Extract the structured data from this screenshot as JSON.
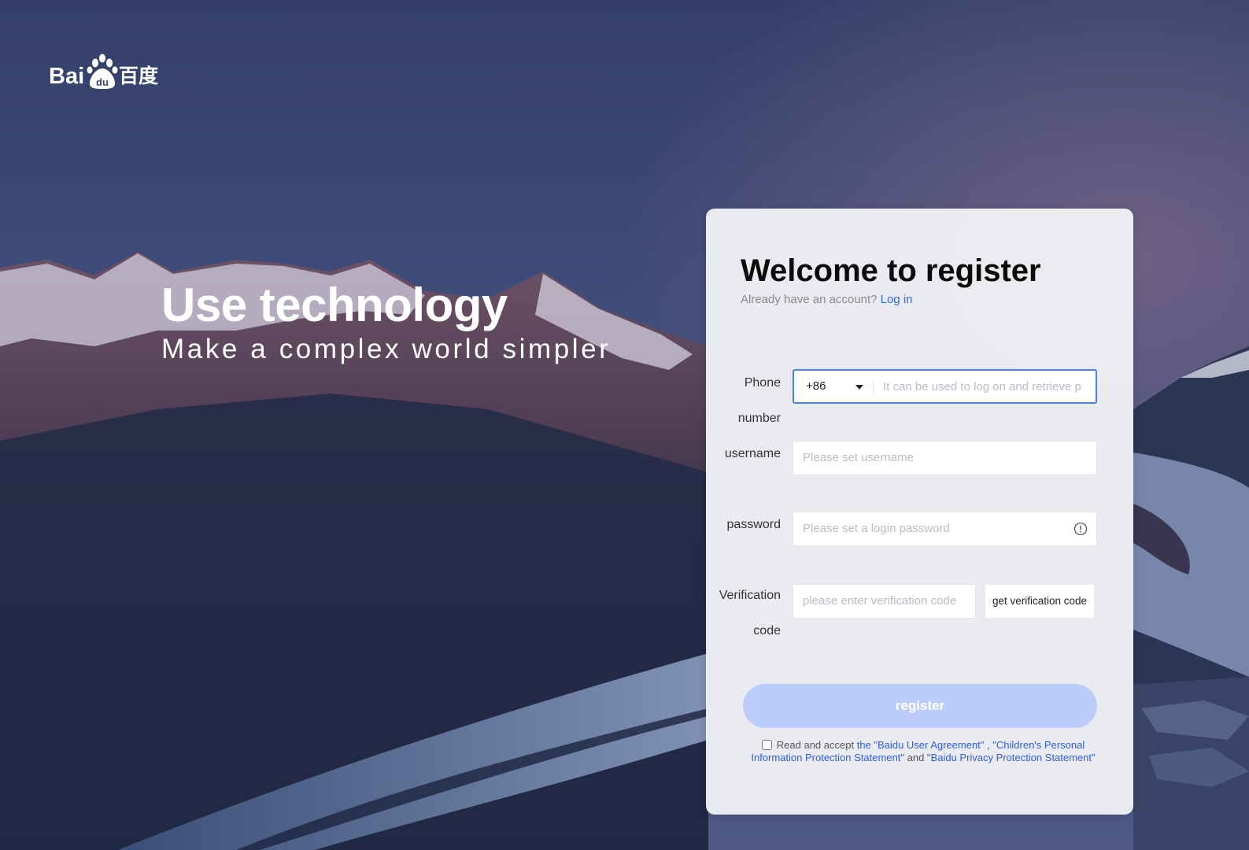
{
  "brand": {
    "logo_latin": "Bai",
    "logo_paw_text": "du",
    "logo_chinese": "百度",
    "accent_color": "#2f68f0"
  },
  "hero": {
    "title": "Use technology",
    "subtitle": "Make a complex world simpler"
  },
  "form": {
    "title": "Welcome to register",
    "already_text": "Already have an account?",
    "login_link": "Log in",
    "phone": {
      "label_line1": "Phone",
      "label_line2": "number",
      "country_code": "+86",
      "placeholder": "It can be used to log on and retrieve p"
    },
    "username": {
      "label": "username",
      "placeholder": "Please set username"
    },
    "password": {
      "label": "password",
      "placeholder": "Please set a login password",
      "icon": "info-circle-icon"
    },
    "verification": {
      "label_line1": "Verification",
      "label_line2": "code",
      "placeholder": "please enter verification code",
      "button": "get verification code"
    },
    "register_button": "register",
    "agreement": {
      "checked": false,
      "prefix": "Read and accept",
      "link1": "the \"Baidu User Agreement\"",
      "sep1": " , ",
      "link2": "\"Children's Personal Information Protection Statement\"",
      "sep2": " and ",
      "link3": "\"Baidu Privacy Protection Statement\""
    }
  }
}
